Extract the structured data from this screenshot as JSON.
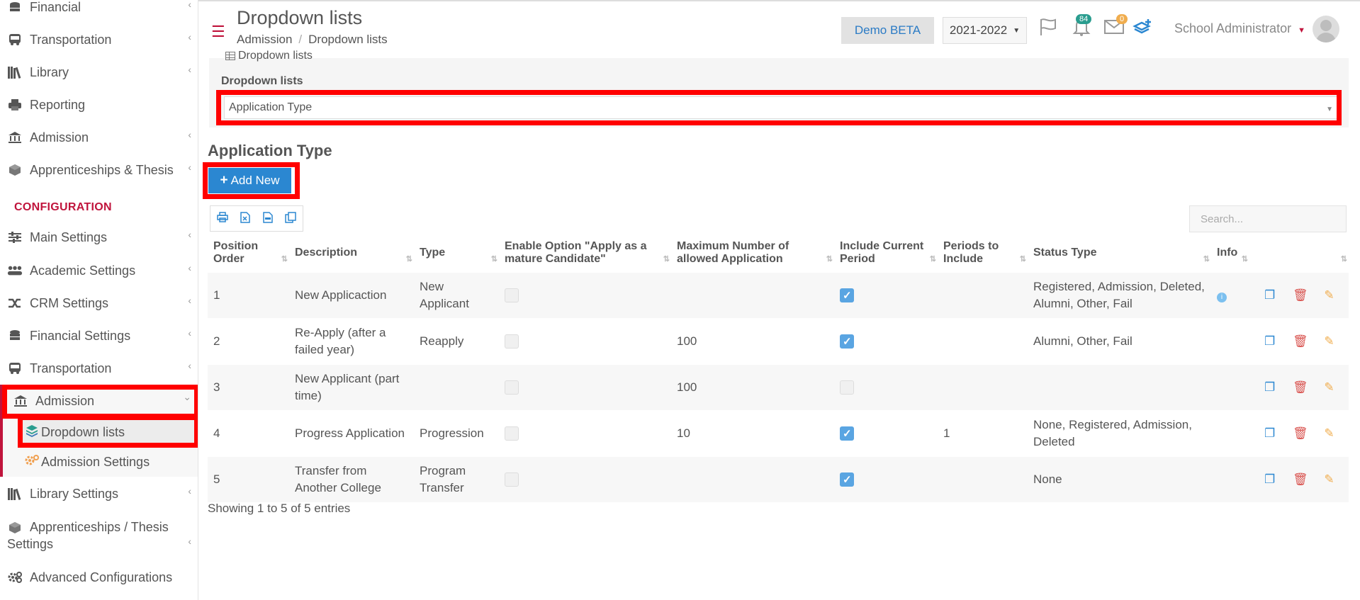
{
  "sidebar": {
    "items_top": [
      {
        "label": "Financial",
        "icon": "coins-icon"
      },
      {
        "label": "Transportation",
        "icon": "bus-icon"
      },
      {
        "label": "Library",
        "icon": "books-icon"
      },
      {
        "label": "Reporting",
        "icon": "printer-icon"
      },
      {
        "label": "Admission",
        "icon": "bank-icon"
      },
      {
        "label": "Apprenticeships & Thesis",
        "icon": "box-icon"
      }
    ],
    "section_label": "CONFIGURATION",
    "items_config": [
      {
        "label": "Main Settings",
        "icon": "sliders-icon"
      },
      {
        "label": "Academic Settings",
        "icon": "users-icon"
      },
      {
        "label": "CRM Settings",
        "icon": "shuffle-icon"
      },
      {
        "label": "Financial Settings",
        "icon": "coins-icon"
      },
      {
        "label": "Transportation",
        "icon": "bus-icon"
      },
      {
        "label": "Admission",
        "icon": "bank-icon"
      },
      {
        "label": "Library Settings",
        "icon": "books-icon"
      },
      {
        "label": "Apprenticeships / Thesis",
        "label2": "Settings",
        "icon": "box-icon"
      },
      {
        "label": "Advanced Configurations",
        "icon": "gears-icon"
      }
    ],
    "sub_items": [
      {
        "label": "Dropdown lists",
        "icon": "layers-icon"
      },
      {
        "label": "Admission Settings",
        "icon": "gear-icon"
      }
    ]
  },
  "header": {
    "title": "Dropdown lists",
    "breadcrumb": [
      "Admission",
      "/",
      "Dropdown lists"
    ],
    "demo_label": "Demo BETA",
    "year_label": "2021-2022",
    "notif_count": "84",
    "mail_count": "0",
    "user_name": "School Administrator"
  },
  "panel": {
    "heading": "Dropdown lists",
    "field_label": "Dropdown lists",
    "selected": "Application Type"
  },
  "section_title": "Application Type",
  "add_button": "Add New",
  "search_placeholder": "Search...",
  "table": {
    "headers": [
      "Position Order",
      "Description",
      "Type",
      "Enable Option \"Apply as a mature Candidate\"",
      "Maximum Number of allowed Application",
      "Include Current Period",
      "Periods to Include",
      "Status Type",
      "Info"
    ],
    "rows": [
      {
        "pos": "1",
        "desc": "New Applicaction",
        "type": "New Applicant",
        "mature": false,
        "max": "",
        "current": true,
        "periods": "",
        "status": "Registered, Admission, Deleted, Alumni, Other, Fail",
        "info": true
      },
      {
        "pos": "2",
        "desc": "Re-Apply (after a failed year)",
        "type": "Reapply",
        "mature": false,
        "max": "100",
        "current": true,
        "periods": "",
        "status": "Alumni, Other, Fail",
        "info": false
      },
      {
        "pos": "3",
        "desc": "New Applicant (part time)",
        "type": "",
        "mature": false,
        "max": "100",
        "current": false,
        "periods": "",
        "status": "",
        "info": false
      },
      {
        "pos": "4",
        "desc": "Progress Application",
        "type": "Progression",
        "mature": false,
        "max": "10",
        "current": true,
        "periods": "1",
        "status": "None, Registered, Admission, Deleted",
        "info": false
      },
      {
        "pos": "5",
        "desc": "Transfer from Another College",
        "type": "Program Transfer",
        "mature": false,
        "max": "",
        "current": true,
        "periods": "",
        "status": "None",
        "info": false
      }
    ]
  },
  "footer_text": "Showing 1 to 5 of 5 entries",
  "colors": {
    "accent": "#c0143c",
    "primary": "#2b87d1",
    "highlight": "#ff0000"
  }
}
